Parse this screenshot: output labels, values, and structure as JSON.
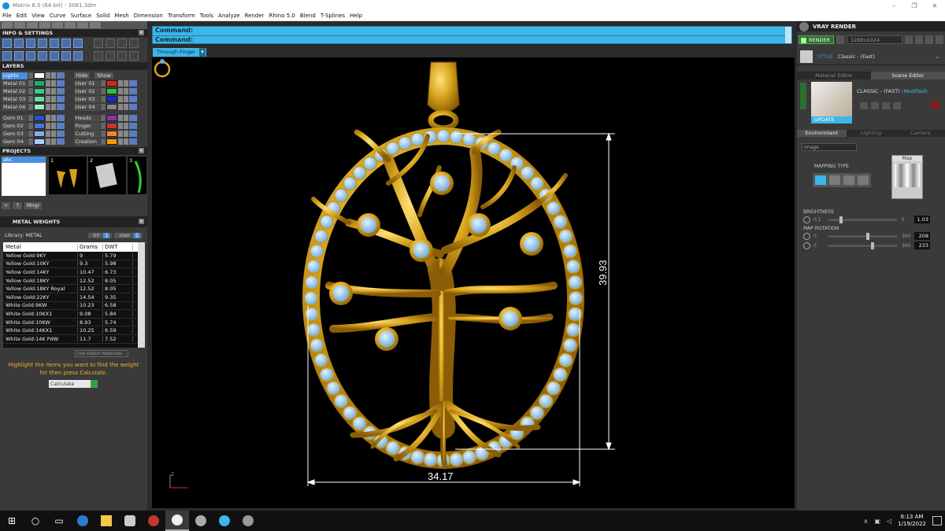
{
  "window": {
    "title": "Matrix 8.0 (64-bit) - 3081.3dm",
    "controls": [
      "–",
      "❐",
      "✕"
    ]
  },
  "menu": [
    "File",
    "Edit",
    "View",
    "Curve",
    "Surface",
    "Solid",
    "Mesh",
    "Dimension",
    "Transform",
    "Tools",
    "Analyze",
    "Render",
    "Rhino 5.0",
    "Blend",
    "T-Splines",
    "Help"
  ],
  "left": {
    "info_title": "INFO & SETTINGS",
    "layers_title": "LAYERS",
    "hide_label": "Hide",
    "show_label": "Show",
    "layers_left": [
      {
        "name": "Lights",
        "color": "#ffffff",
        "selected": true
      },
      {
        "name": "Metal 01",
        "color": "#22aa66"
      },
      {
        "name": "Metal 02",
        "color": "#33cc88"
      },
      {
        "name": "Metal 03",
        "color": "#66ddaa"
      },
      {
        "name": "Metal 04",
        "color": "#99eebb"
      },
      {
        "name": "Gem 01",
        "color": "#2255cc"
      },
      {
        "name": "Gem 02",
        "color": "#4477dd"
      },
      {
        "name": "Gem 03",
        "color": "#88aaee"
      },
      {
        "name": "Gem 04",
        "color": "#aaccff"
      }
    ],
    "layers_right": [
      null,
      {
        "name": "User 01",
        "color": "#dd2222"
      },
      {
        "name": "User 02",
        "color": "#22cc22"
      },
      {
        "name": "User 03",
        "color": "#2222dd"
      },
      {
        "name": "User 04",
        "color": "#888888"
      },
      {
        "name": "Heads",
        "color": "#8833aa"
      },
      {
        "name": "Finger",
        "color": "#cc3333"
      },
      {
        "name": "Cutting",
        "color": "#ee8833"
      },
      {
        "name": "Creation",
        "color": "#ff9900"
      }
    ],
    "projects_title": "PROJECTS",
    "project_selected": "abc",
    "thumb_numbers": [
      "1",
      "2",
      "3"
    ],
    "proj_controls": [
      "+",
      "↑",
      "Mngr"
    ],
    "metal_title": "METAL WEIGHTS",
    "library_label": "Library: METAL",
    "toggle_gv": "GV",
    "toggle_user": "User",
    "table_headers": [
      "Metal",
      "Grams",
      "DWT"
    ],
    "metal_rows": [
      [
        "Yellow Gold:9KY",
        "9",
        "5.79"
      ],
      [
        "Yellow Gold:10KY",
        "9.3",
        "5.98"
      ],
      [
        "Yellow Gold:14KY",
        "10.47",
        "6.73"
      ],
      [
        "Yellow Gold:18KY",
        "12.52",
        "8.05"
      ],
      [
        "Yellow Gold:18KY Royal",
        "12.52",
        "8.05"
      ],
      [
        "Yellow Gold:22KY",
        "14.54",
        "9.35"
      ],
      [
        "White Gold:9KW",
        "10.23",
        "6.58"
      ],
      [
        "White Gold:10KX1",
        "9.08",
        "5.84"
      ],
      [
        "White Gold:10KW",
        "8.93",
        "5.74"
      ],
      [
        "White Gold:14KX1",
        "10.25",
        "6.59"
      ],
      [
        "White Gold:14K PdW",
        "11.7",
        "7.52"
      ]
    ],
    "use_object_label": "Use Object Materials",
    "hint_text": "Highlight the items you want to find the weight for then press Calculate.",
    "calculate_label": "Calculate"
  },
  "command": {
    "line1": "Command:",
    "line2": "Command:"
  },
  "viewport": {
    "view_mode": "Through Finger",
    "dim_width": "34.17",
    "dim_height": "39.93"
  },
  "right": {
    "vray_title": "VRAY RENDER",
    "render_btn": "RENDER",
    "resolution": "1280x1024",
    "style_label": "STYLE",
    "style_value": "Classic - (Fast)",
    "tab_material": "Material Editor",
    "tab_scene": "Scene Editor",
    "preset_name": "CLASSIC - (FAST)",
    "preset_modified": "(Modified)",
    "update_label": "UPDATE",
    "env_tabs": [
      "Environment",
      "Lighting",
      "Camera"
    ],
    "env_dropdown": "Image",
    "mapping_label": "MAPPING TYPE",
    "map_label": "Map",
    "brightness_label": "BRIGHTNESS",
    "brightness_min": "0.1",
    "brightness_max": "5",
    "brightness_value": "1.03",
    "brightness_fraction": 0.19,
    "map_rotation_label": "MAP ROTATION",
    "rot1_min": "0",
    "rot1_max": "360",
    "rot1_value": "208",
    "rot1_fraction": 0.578,
    "rot2_min": "0",
    "rot2_max": "360",
    "rot2_value": "233",
    "rot2_fraction": 0.647
  },
  "taskbar": {
    "time": "6:13 AM",
    "date": "1/19/2022",
    "apps": [
      "search",
      "task-view",
      "edge",
      "file-explorer",
      "paint",
      "app-red",
      "app-active",
      "chrome",
      "app-blue",
      "app-bird"
    ]
  },
  "colors": {
    "accent": "#3db6e8",
    "gold": "#d4a21a",
    "gem_blue": "#8cc4f0",
    "hint": "#f2b221"
  }
}
